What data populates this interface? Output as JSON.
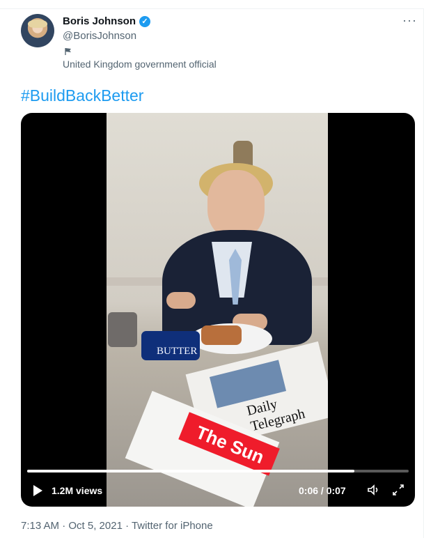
{
  "tweet": {
    "author_name": "Boris Johnson",
    "verified_symbol": "✓",
    "author_handle": "@BorisJohnson",
    "account_label": "United Kingdom government official",
    "more_symbol": "···",
    "hashtag": "#BuildBackBetter",
    "timestamp": "7:13 AM · Oct 5, 2021 · Twitter for iPhone"
  },
  "video": {
    "views": "1.2M views",
    "time": "0:06 / 0:07",
    "progress_fraction": 0.857,
    "scene_text": {
      "butter": "BUTTER",
      "newspaper_left": "Daily Telegraph",
      "newspaper_right": "The Sun"
    }
  },
  "icons": {
    "verified": "verified-badge-icon",
    "flag": "flag-icon",
    "more": "more-options-icon",
    "play": "play-icon",
    "sound": "sound-icon",
    "fullscreen": "fullscreen-icon"
  },
  "colors": {
    "accent": "#1d9bf0",
    "text_primary": "#0f1419",
    "text_secondary": "#536471",
    "video_background": "#000000"
  }
}
